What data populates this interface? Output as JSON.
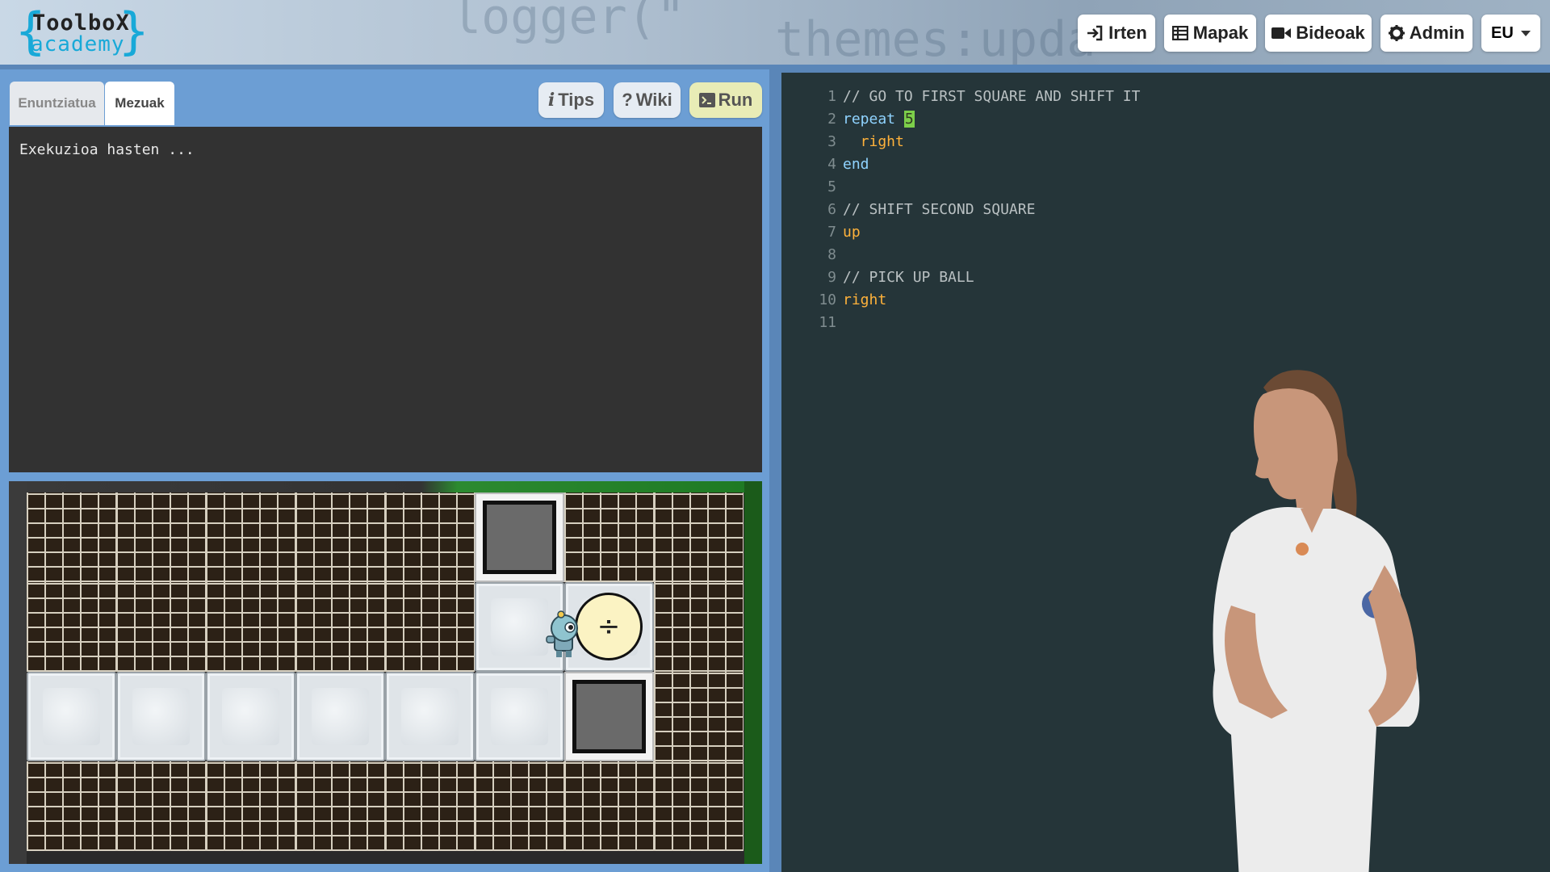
{
  "header": {
    "logo": {
      "line1": "ToolboX",
      "line2": "academy"
    },
    "buttons": {
      "exit": "Irten",
      "maps": "Mapak",
      "videos": "Bideoak",
      "admin": "Admin"
    },
    "language": "EU",
    "background_code": "themes:upda"
  },
  "tabs": [
    {
      "label": "Enuntziatua",
      "active": false
    },
    {
      "label": "Mezuak",
      "active": true
    }
  ],
  "toolbar": {
    "tips": "Tips",
    "wiki": "Wiki",
    "run": "Run"
  },
  "console": {
    "text": "Exekuzioa hasten ..."
  },
  "game": {
    "ball_symbol": "÷",
    "board": [
      "wall",
      "wall",
      "wall",
      "wall",
      "wall",
      "square",
      "wall",
      "wall",
      "wall",
      "wall",
      "wall",
      "wall",
      "wall",
      "floor",
      "floor",
      "wall",
      "floor",
      "floor",
      "floor",
      "floor",
      "floor",
      "floor",
      "square",
      "wall",
      "wall",
      "wall",
      "wall",
      "wall",
      "wall",
      "wall",
      "wall",
      "wall"
    ]
  },
  "editor": {
    "lines": [
      {
        "n": "1",
        "parts": [
          {
            "t": "// GO TO FIRST SQUARE AND SHIFT IT",
            "c": "comment"
          }
        ]
      },
      {
        "n": "2",
        "parts": [
          {
            "t": "repeat ",
            "c": "kw"
          },
          {
            "t": "5",
            "c": "num"
          }
        ]
      },
      {
        "n": "3",
        "parts": [
          {
            "t": "  right",
            "c": "cmd"
          }
        ]
      },
      {
        "n": "4",
        "parts": [
          {
            "t": "end",
            "c": "kw"
          }
        ]
      },
      {
        "n": "5",
        "parts": []
      },
      {
        "n": "6",
        "parts": [
          {
            "t": "// SHIFT SECOND SQUARE",
            "c": "comment"
          }
        ]
      },
      {
        "n": "7",
        "parts": [
          {
            "t": "up",
            "c": "cmd"
          }
        ]
      },
      {
        "n": "8",
        "parts": []
      },
      {
        "n": "9",
        "parts": [
          {
            "t": "// PICK UP BALL",
            "c": "comment"
          }
        ]
      },
      {
        "n": "10",
        "parts": [
          {
            "t": "right",
            "c": "cmd"
          }
        ]
      },
      {
        "n": "11",
        "parts": []
      }
    ]
  }
}
